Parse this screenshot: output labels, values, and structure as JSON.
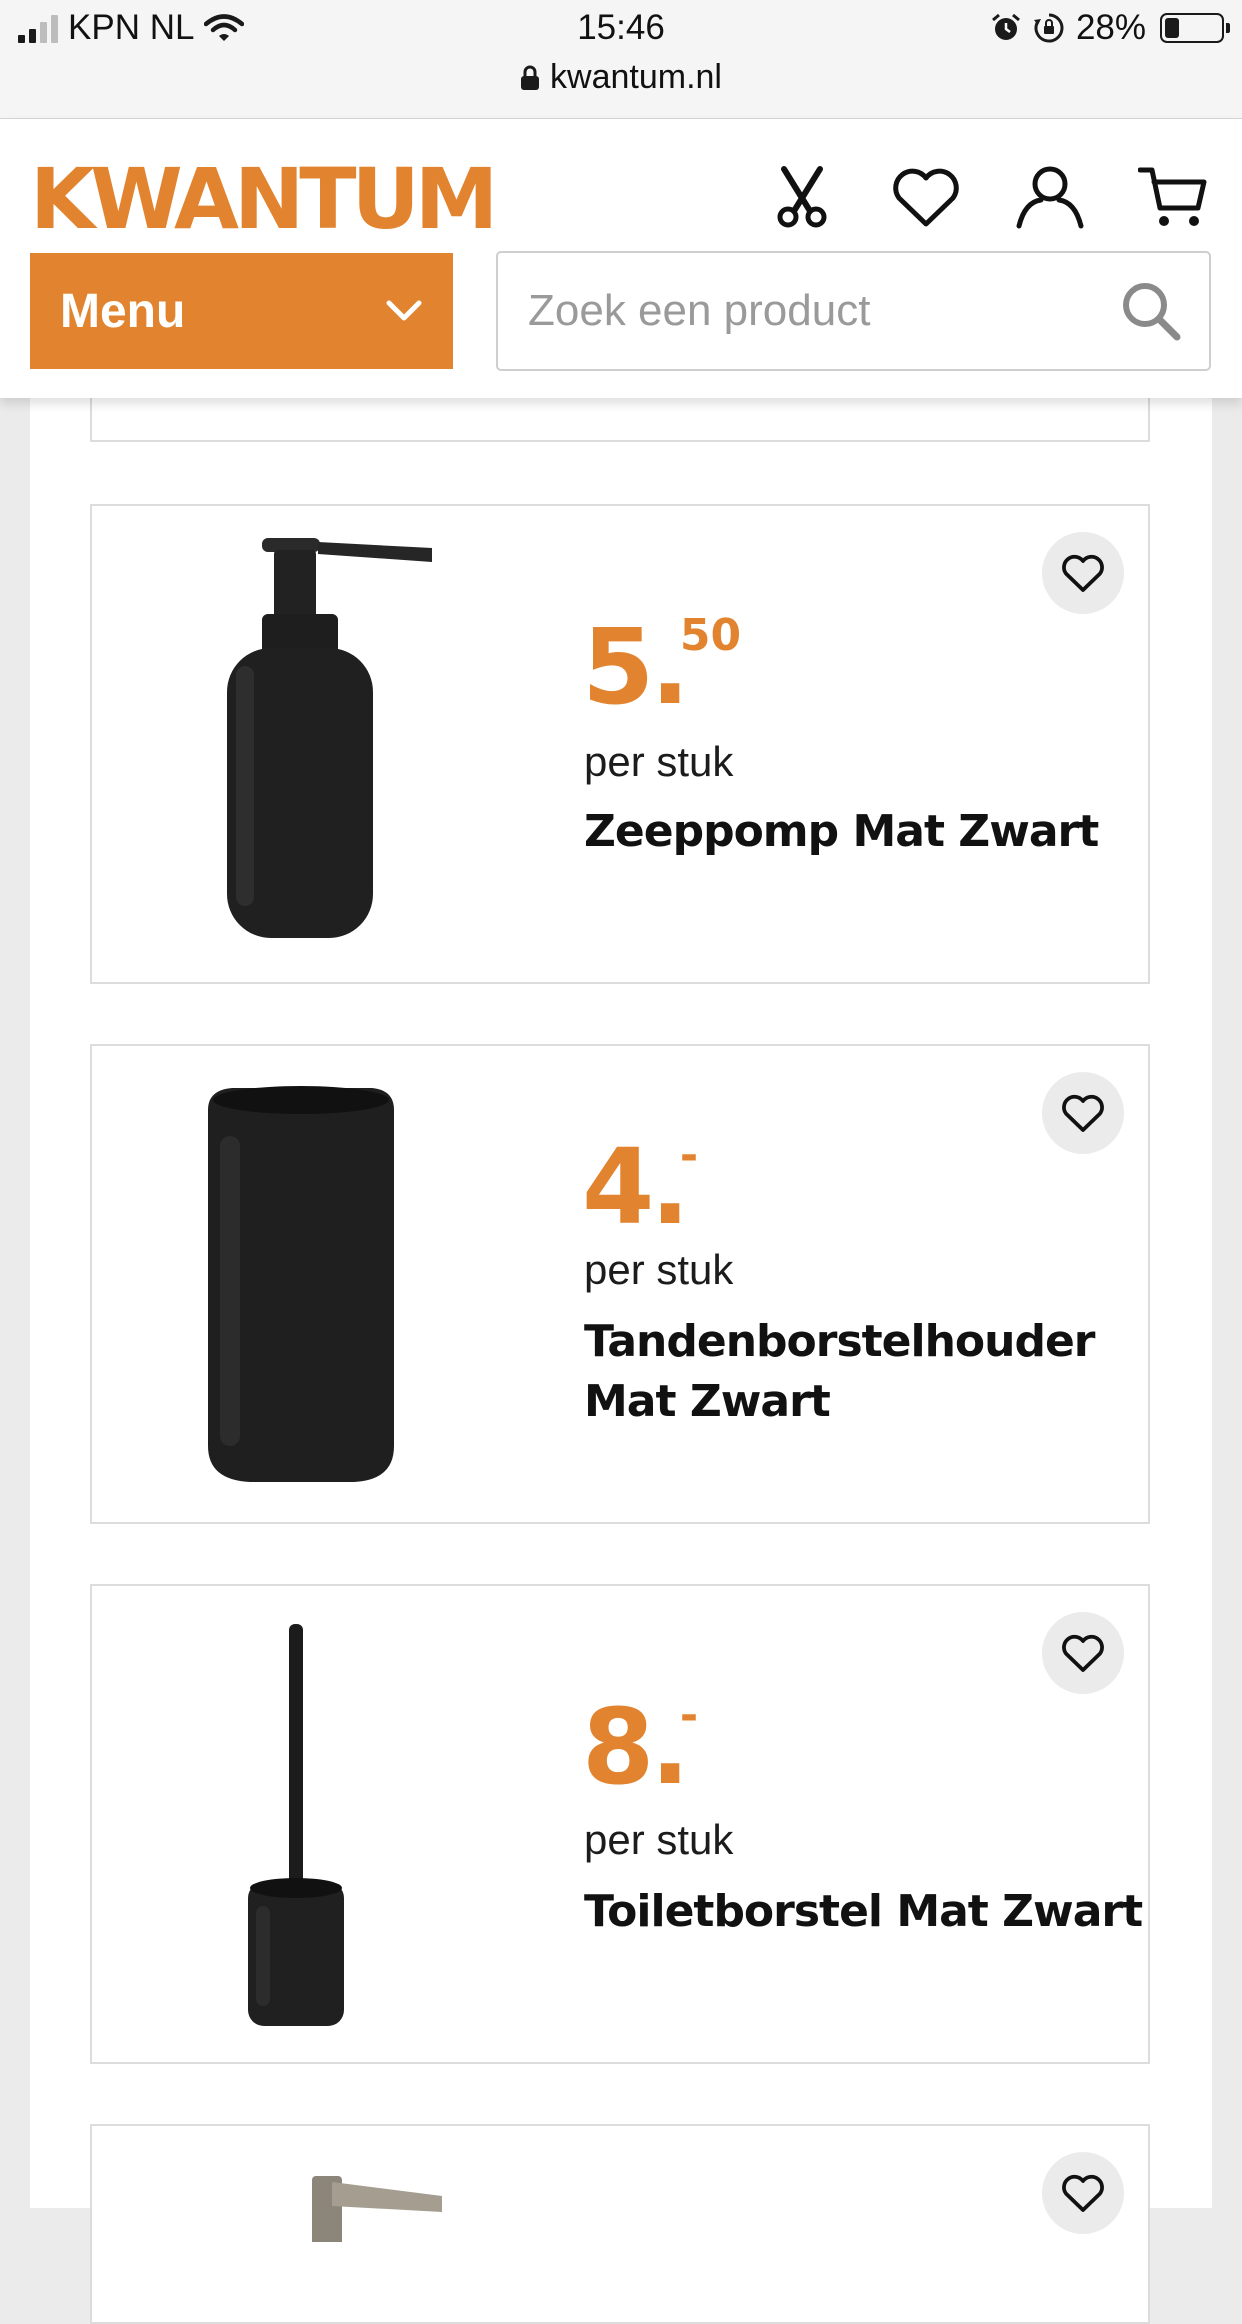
{
  "status_bar": {
    "carrier": "KPN NL",
    "time": "15:46",
    "battery": "28%",
    "battery_level": 0.28,
    "url": "kwantum.nl"
  },
  "header": {
    "logo": "KWANTUM",
    "menu_label": "Menu",
    "search_placeholder": "Zoek een product",
    "brand_color": "#e2842f"
  },
  "products": [
    {
      "price_int": "5.",
      "price_cents": "50",
      "unit": "per stuk",
      "name": "Zeeppomp Mat Zwart",
      "image": "soap-pump"
    },
    {
      "price_int": "4.",
      "price_cents": "-",
      "unit": "per stuk",
      "name": "Tandenborstelhouder Mat Zwart",
      "image": "toothbrush-holder"
    },
    {
      "price_int": "8.",
      "price_cents": "-",
      "unit": "per stuk",
      "name": "Toiletborstel Mat Zwart",
      "image": "toilet-brush"
    }
  ]
}
